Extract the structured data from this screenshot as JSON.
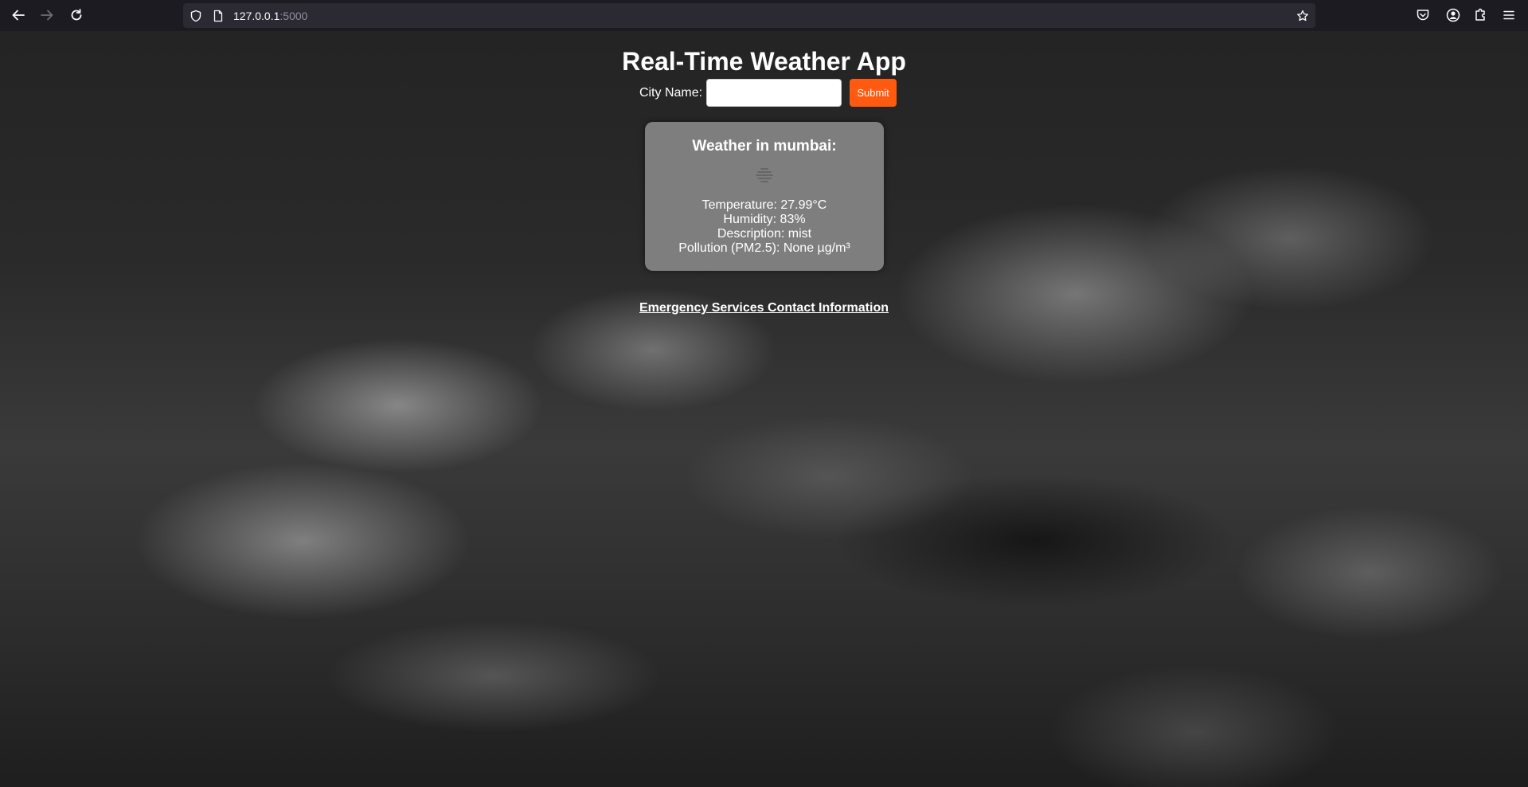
{
  "browser": {
    "url_host": "127.0.0.1",
    "url_port": ":5000",
    "icons": [
      "back-arrow-icon",
      "forward-arrow-icon",
      "reload-icon",
      "shield-icon",
      "page-icon",
      "star-icon",
      "pocket-icon",
      "account-icon",
      "extensions-icon",
      "menu-icon"
    ]
  },
  "page": {
    "title": "Real-Time Weather App",
    "form": {
      "city_label": "City Name:",
      "city_value": "",
      "submit_label": "Submit"
    },
    "weather": {
      "heading": "Weather in mumbai:",
      "icon": "mist-icon",
      "temperature": "Temperature: 27.99°C",
      "humidity": "Humidity: 83%",
      "description": "Description: mist",
      "pollution": "Pollution (PM2.5): None µg/m³"
    },
    "emergency_link": "Emergency Services Contact Information"
  },
  "colors": {
    "submit_button": "#ff5a10",
    "card_background": "#7e7e7e",
    "browser_bar": "#1c1b22",
    "url_box": "#2b2a33"
  }
}
